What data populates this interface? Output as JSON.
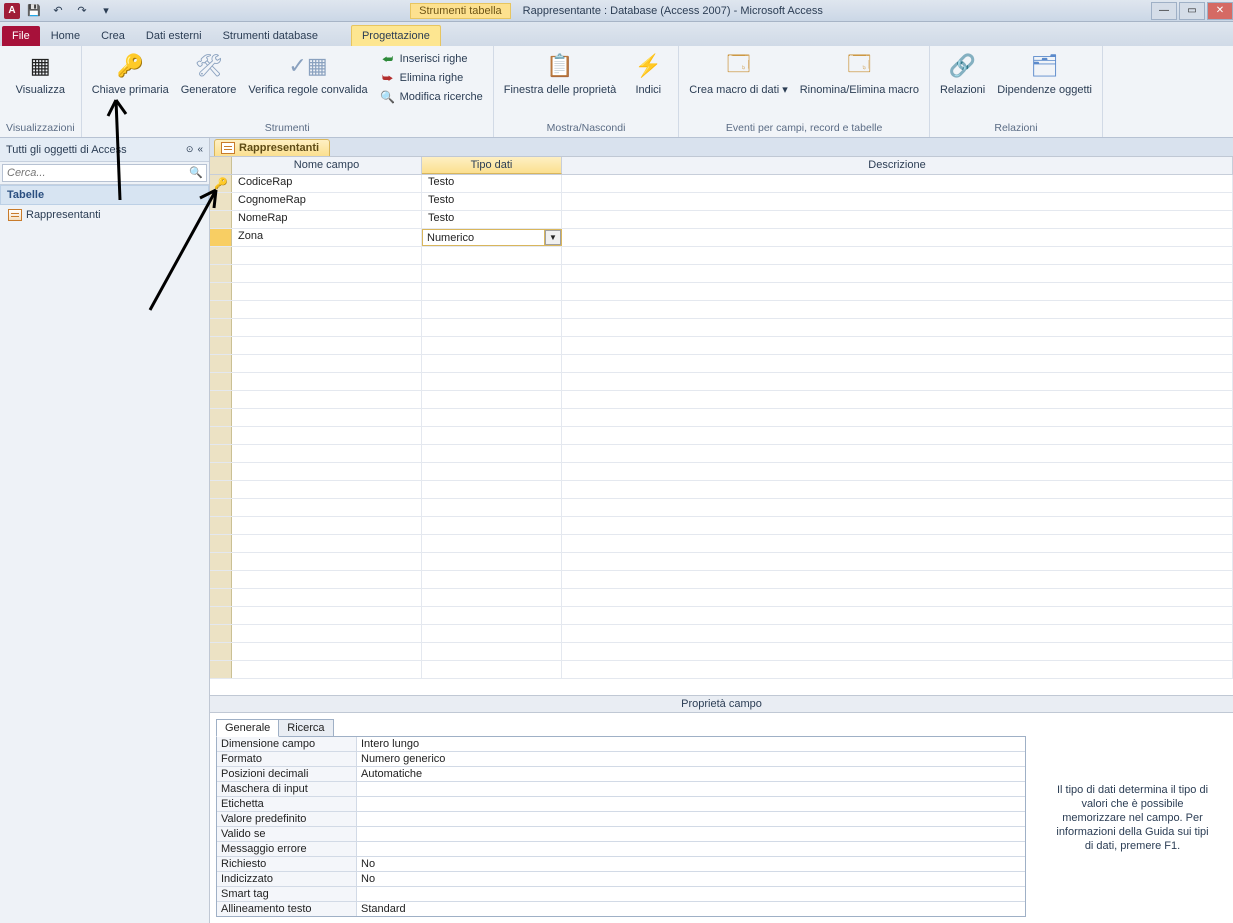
{
  "titlebar": {
    "app_letter": "A",
    "context_title": "Strumenti tabella",
    "title": "Rappresentante : Database (Access 2007)  -  Microsoft Access"
  },
  "ribbon": {
    "tabs": {
      "file": "File",
      "home": "Home",
      "crea": "Crea",
      "dati_esterni": "Dati esterni",
      "strumenti_db": "Strumenti database",
      "progettazione": "Progettazione"
    },
    "groups": {
      "visualizza": "Visualizzazioni",
      "strumenti": "Strumenti",
      "mostra": "Mostra/Nascondi",
      "eventi": "Eventi per campi, record e tabelle",
      "relazioni": "Relazioni"
    },
    "items": {
      "visualizza": "Visualizza",
      "chiave": "Chiave primaria",
      "generatore": "Generatore",
      "verifica": "Verifica regole convalida",
      "inserisci_righe": "Inserisci righe",
      "elimina_righe": "Elimina righe",
      "modifica_ricerche": "Modifica ricerche",
      "finestra_prop": "Finestra delle proprietà",
      "indici": "Indici",
      "crea_macro": "Crea macro di dati ▾",
      "rinomina_macro": "Rinomina/Elimina macro",
      "relazioni": "Relazioni",
      "dipendenze": "Dipendenze oggetti"
    }
  },
  "navpane": {
    "header": "Tutti gli oggetti di Access",
    "search_placeholder": "Cerca...",
    "group_tabelle": "Tabelle",
    "obj_rappresentanti": "Rappresentanti"
  },
  "doc_tab": "Rappresentanti",
  "grid_headers": {
    "name": "Nome campo",
    "type": "Tipo dati",
    "desc": "Descrizione"
  },
  "fields": [
    {
      "name": "CodiceRap",
      "type": "Testo",
      "key": true
    },
    {
      "name": "CognomeRap",
      "type": "Testo"
    },
    {
      "name": "NomeRap",
      "type": "Testo"
    },
    {
      "name": "Zona",
      "type": "Numerico",
      "selected": true
    }
  ],
  "propsheet": {
    "title": "Proprietà campo",
    "tabs": {
      "generale": "Generale",
      "ricerca": "Ricerca"
    },
    "rows": [
      {
        "k": "Dimensione campo",
        "v": "Intero lungo"
      },
      {
        "k": "Formato",
        "v": "Numero generico"
      },
      {
        "k": "Posizioni decimali",
        "v": "Automatiche"
      },
      {
        "k": "Maschera di input",
        "v": ""
      },
      {
        "k": "Etichetta",
        "v": ""
      },
      {
        "k": "Valore predefinito",
        "v": ""
      },
      {
        "k": "Valido se",
        "v": ""
      },
      {
        "k": "Messaggio errore",
        "v": ""
      },
      {
        "k": "Richiesto",
        "v": "No"
      },
      {
        "k": "Indicizzato",
        "v": "No"
      },
      {
        "k": "Smart tag",
        "v": ""
      },
      {
        "k": "Allineamento testo",
        "v": "Standard"
      }
    ],
    "help": "Il tipo di dati determina il tipo di valori che è possibile memorizzare nel campo. Per informazioni della Guida sui tipi di dati, premere F1."
  }
}
